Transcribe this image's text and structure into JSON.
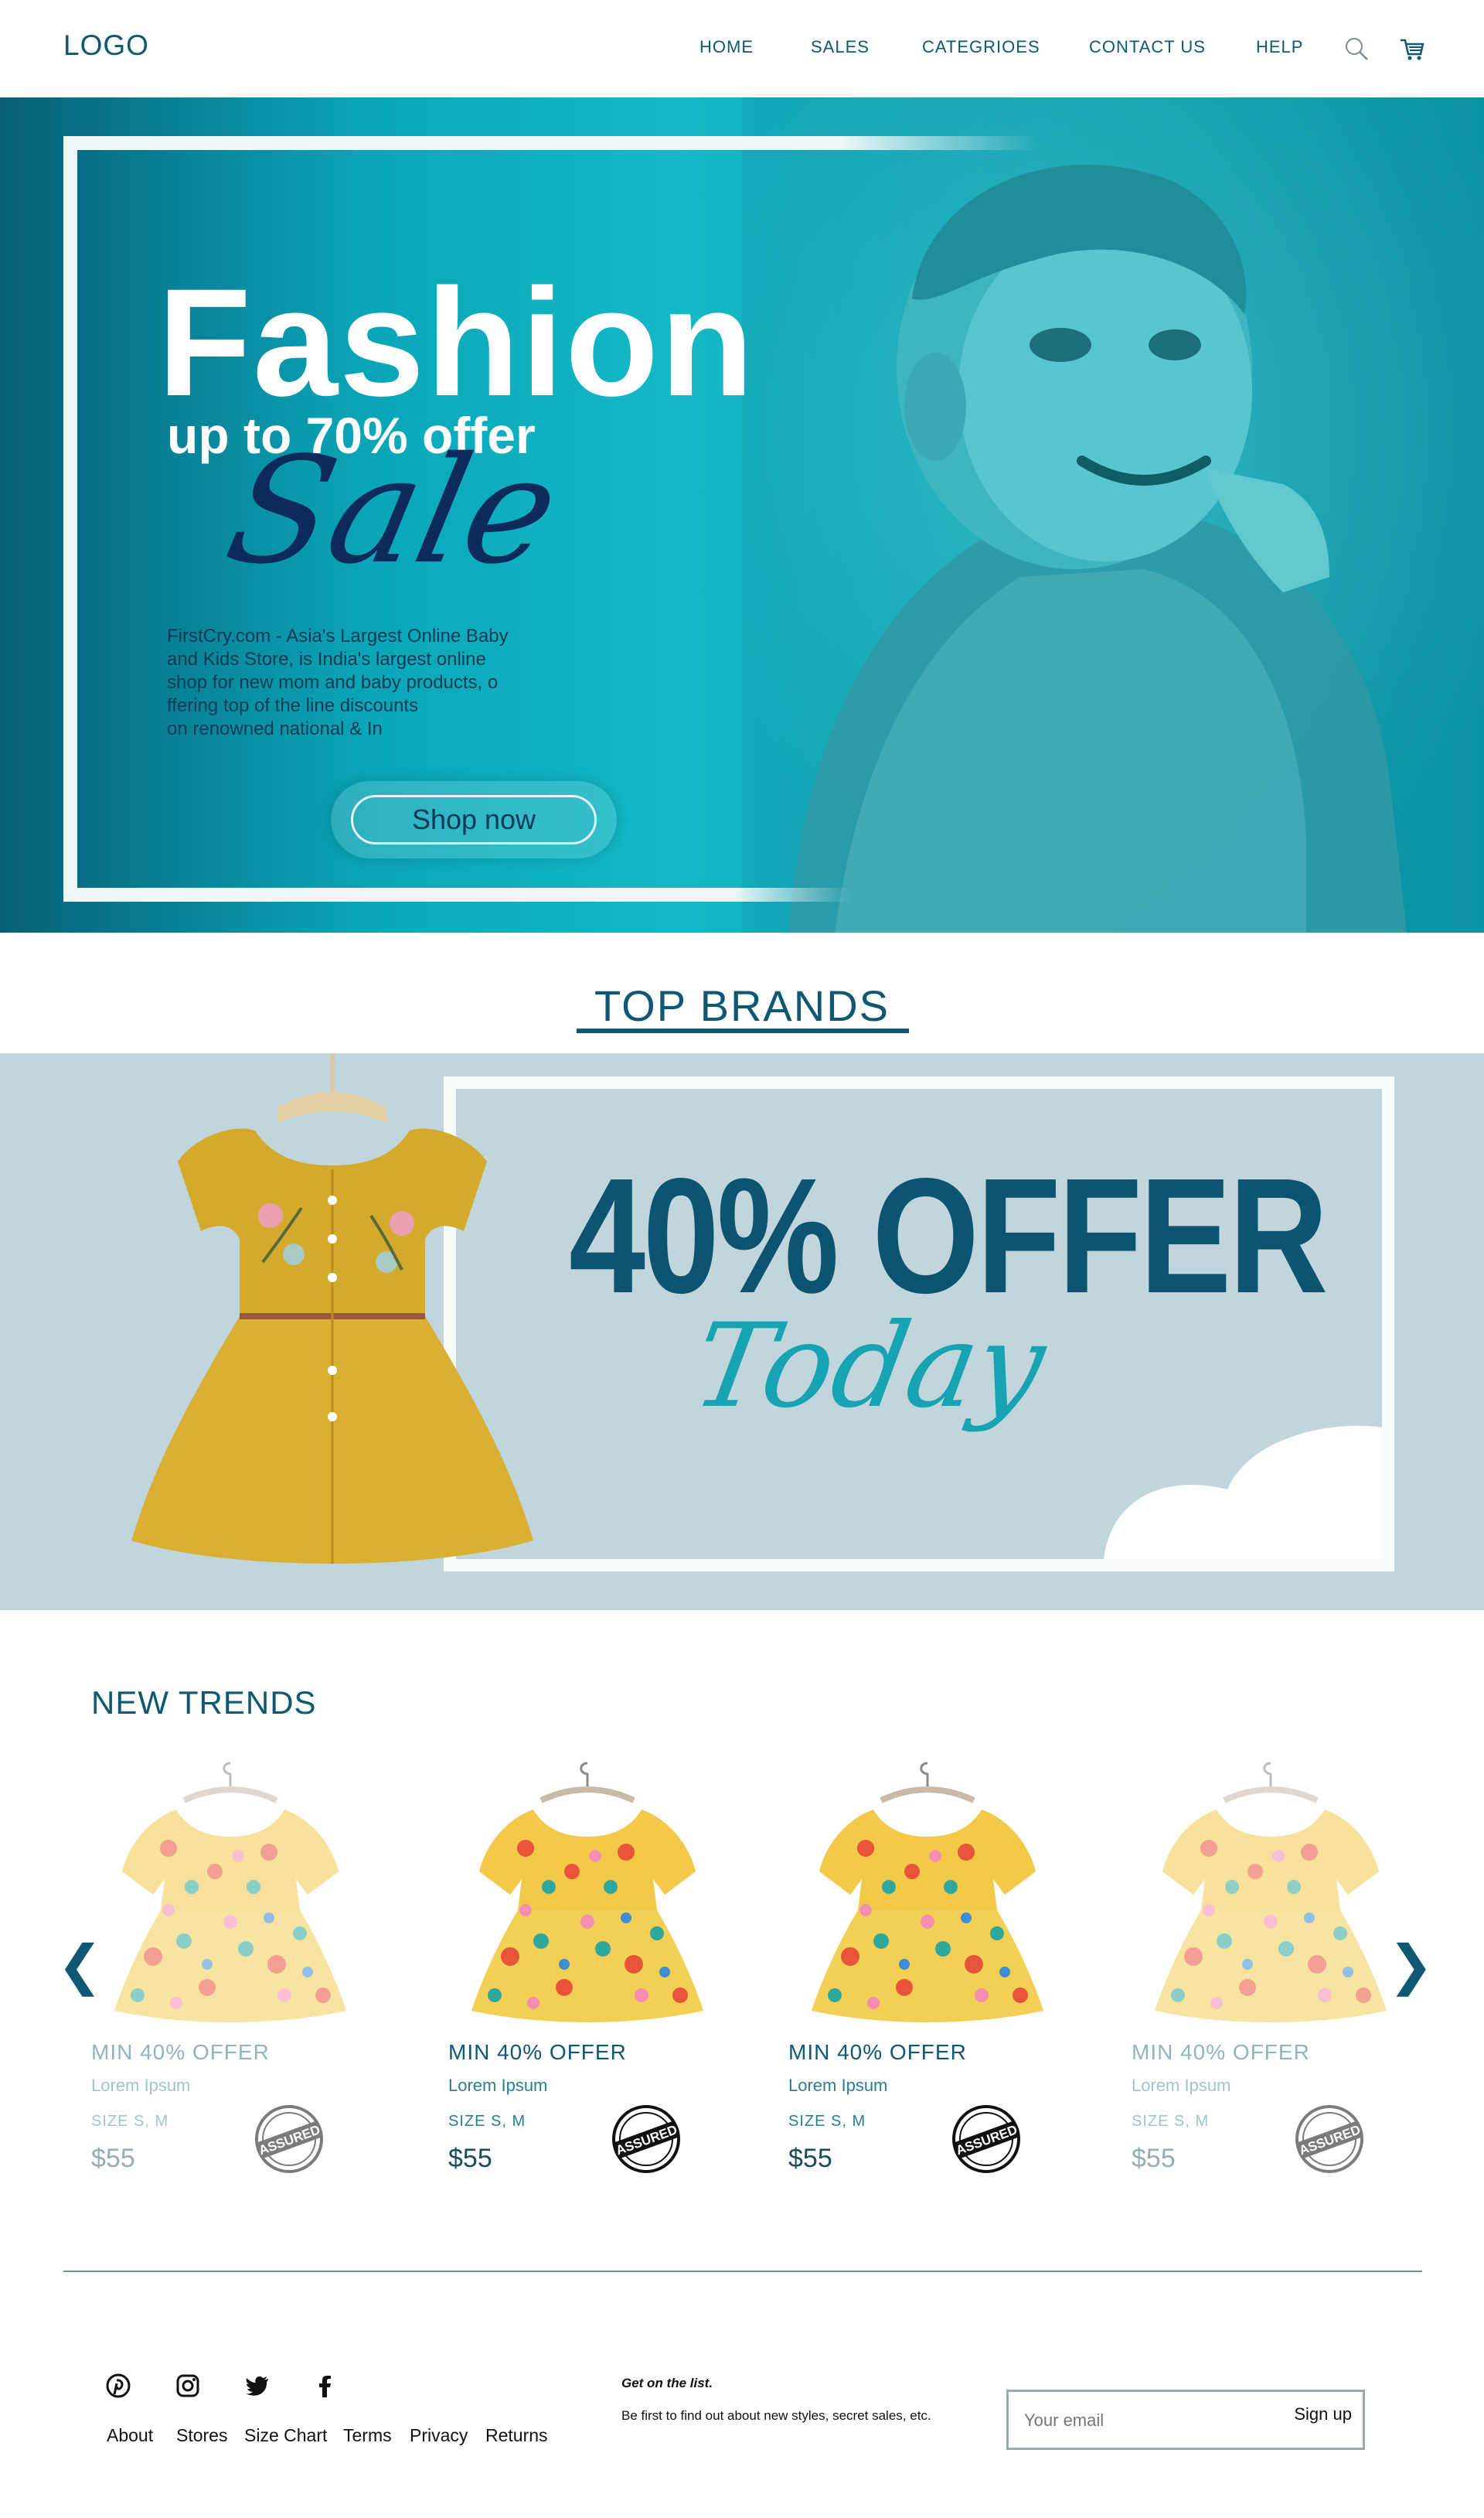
{
  "nav": {
    "logo": "LOGO",
    "items": [
      "HOME",
      "SALES",
      "CATEGRIOES",
      "CONTACT US",
      "HELP"
    ]
  },
  "hero": {
    "title": "Fashion",
    "subtitle": "up to 70% offer",
    "script": "Sale",
    "description": "FirstCry.com - Asia's Largest Online Baby\nand Kids Store, is India's largest online\n shop for new mom and baby products, o\nffering top of the line discounts\non renowned national & In",
    "button": "Shop now"
  },
  "brands": {
    "title": "TOP BRANDS",
    "offer_big": "40% OFFER",
    "offer_script": "Today"
  },
  "trends": {
    "title": "NEW TRENDS",
    "prev_icon": "chevron-left-icon",
    "next_icon": "chevron-right-icon",
    "cards": [
      {
        "offer": "MIN 40% OFFER",
        "desc": "Lorem Ipsum",
        "size": "SIZE  S, M",
        "price": "$55",
        "badge": "ASSURED"
      },
      {
        "offer": "MIN 40% OFFER",
        "desc": "Lorem Ipsum",
        "size": "SIZE  S, M",
        "price": "$55",
        "badge": "ASSURED"
      },
      {
        "offer": "MIN 40% OFFER",
        "desc": "Lorem Ipsum",
        "size": "SIZE  S, M",
        "price": "$55",
        "badge": "ASSURED"
      },
      {
        "offer": "MIN 40% OFFER",
        "desc": "Lorem Ipsum",
        "size": "SIZE  S, M",
        "price": "$55",
        "badge": "ASSURED"
      }
    ]
  },
  "footer": {
    "social": [
      "pinterest-icon",
      "instagram-icon",
      "twitter-icon",
      "facebook-icon"
    ],
    "links": [
      "About",
      "Stores",
      "Size Chart",
      "Terms",
      "Privacy",
      "Returns"
    ],
    "list_title": "Get on the list.",
    "list_desc": "Be first to find out about new styles, secret sales, etc.",
    "email_placeholder": "Your email",
    "signup": "Sign up"
  },
  "colors": {
    "brand": "#0f5873",
    "hero_teal": "#13b8c6",
    "offer_bg": "#c0d5dc",
    "accent_script": "#17a3b1",
    "sale_navy": "#0d2a5c"
  }
}
